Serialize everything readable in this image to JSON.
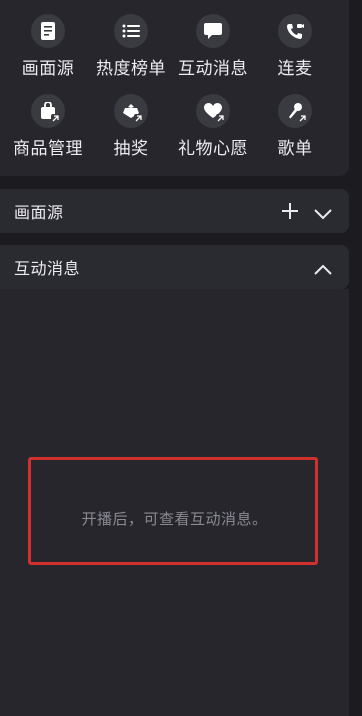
{
  "tools": {
    "row1": [
      {
        "label": "画面源",
        "icon": "document-icon"
      },
      {
        "label": "热度榜单",
        "icon": "list-icon"
      },
      {
        "label": "互动消息",
        "icon": "chat-bubble-icon"
      },
      {
        "label": "连麦",
        "icon": "phone-video-icon"
      }
    ],
    "row2": [
      {
        "label": "商品管理",
        "icon": "shopping-bag-icon"
      },
      {
        "label": "抽奖",
        "icon": "lottery-icon"
      },
      {
        "label": "礼物心愿",
        "icon": "gift-heart-icon"
      },
      {
        "label": "歌单",
        "icon": "microphone-icon"
      }
    ]
  },
  "sections": {
    "source": {
      "title": "画面源"
    },
    "messages": {
      "title": "互动消息",
      "empty_text": "开播后，可查看互动消息。"
    }
  },
  "colors": {
    "background": "#1b1b20",
    "panel": "#26262c",
    "icon_circle": "#3a3a41",
    "highlight_border": "#d0302e",
    "muted_text": "#8a8a93"
  }
}
